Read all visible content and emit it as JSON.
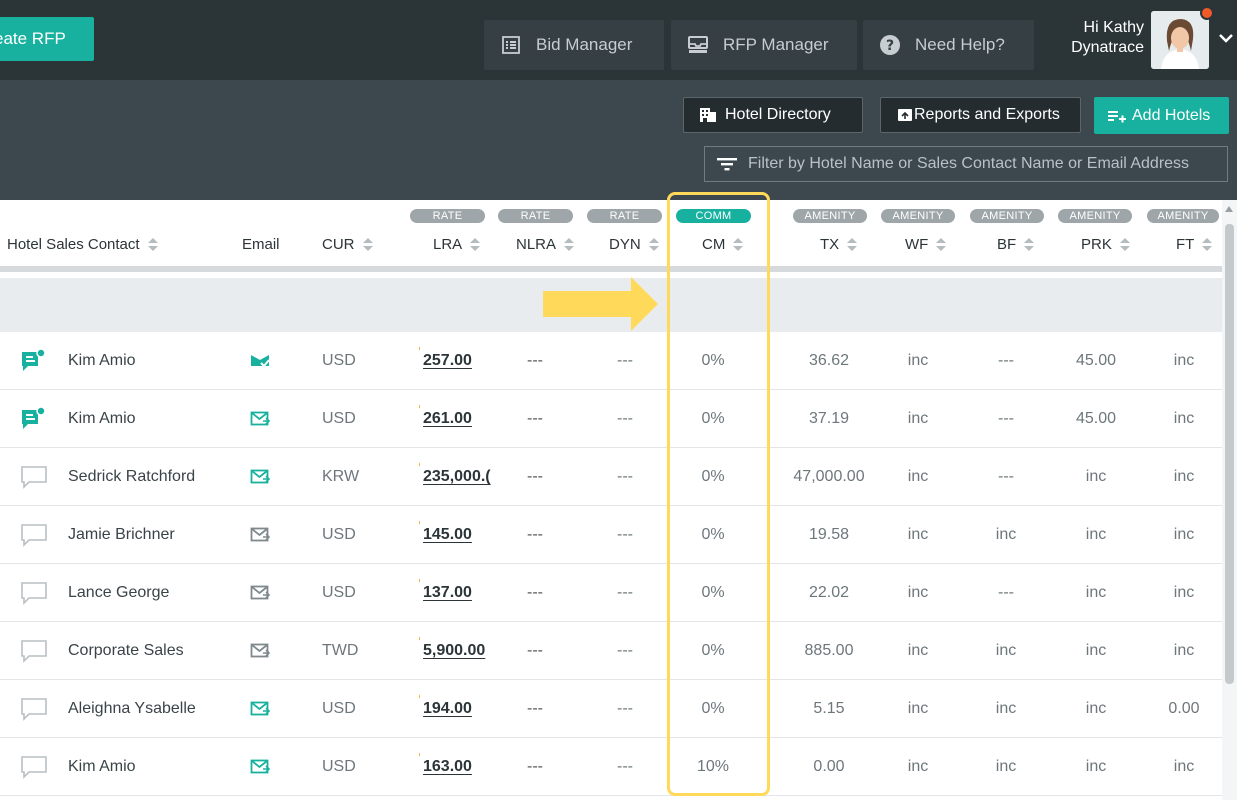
{
  "topbar": {
    "create_rfp_label": "eate RFP",
    "bid_manager_label": "Bid Manager",
    "rfp_manager_label": "RFP Manager",
    "help_label": "Need Help?",
    "greeting": "Hi Kathy",
    "company": "Dynatrace",
    "icons": {
      "bid_manager": "list-icon",
      "rfp_manager": "inbox-icon",
      "help": "question-circle-icon",
      "user_menu": "chevron-down-icon"
    }
  },
  "toolbar": {
    "hotel_directory_label": "Hotel Directory",
    "reports_label": "Reports and Exports",
    "add_hotels_label": "Add Hotels",
    "filter_placeholder": "Filter by Hotel Name or Sales Contact Name or Email Address"
  },
  "colors": {
    "accent": "#18b19f",
    "nav_bg": "#2b3538",
    "toolbar_bg": "#3c484e",
    "highlight": "#ffd95a",
    "lra_marker": "#f5a623"
  },
  "table": {
    "groups": {
      "rate": "RATE",
      "comm": "COMM",
      "amenity": "AMENITY"
    },
    "columns": {
      "contact": "Hotel Sales Contact",
      "email": "Email",
      "cur": "CUR",
      "lra": "LRA",
      "nlra": "NLRA",
      "dyn": "DYN",
      "cm": "CM",
      "tx": "TX",
      "wf": "WF",
      "bf": "BF",
      "prk": "PRK",
      "ft": "FT"
    },
    "rows": [
      {
        "contact": "Kim Amio",
        "chat": "active",
        "email_state": "sent",
        "cur": "USD",
        "lra": "257.00",
        "nlra": "---",
        "dyn": "---",
        "cm": "0%",
        "tx": "36.62",
        "wf": "inc",
        "bf": "---",
        "prk": "45.00",
        "ft": "inc"
      },
      {
        "contact": "Kim Amio",
        "chat": "active",
        "email_state": "reply",
        "cur": "USD",
        "lra": "261.00",
        "nlra": "---",
        "dyn": "---",
        "cm": "0%",
        "tx": "37.19",
        "wf": "inc",
        "bf": "---",
        "prk": "45.00",
        "ft": "inc"
      },
      {
        "contact": "Sedrick Ratchford",
        "chat": "empty",
        "email_state": "reply",
        "cur": "KRW",
        "lra": "235,000.(",
        "nlra": "---",
        "dyn": "---",
        "cm": "0%",
        "tx": "47,000.00",
        "wf": "inc",
        "bf": "---",
        "prk": "inc",
        "ft": "inc"
      },
      {
        "contact": "Jamie Brichner",
        "chat": "empty",
        "email_state": "grey",
        "cur": "USD",
        "lra": "145.00",
        "nlra": "---",
        "dyn": "---",
        "cm": "0%",
        "tx": "19.58",
        "wf": "inc",
        "bf": "inc",
        "prk": "inc",
        "ft": "inc"
      },
      {
        "contact": "Lance George",
        "chat": "empty",
        "email_state": "grey",
        "cur": "USD",
        "lra": "137.00",
        "nlra": "---",
        "dyn": "---",
        "cm": "0%",
        "tx": "22.02",
        "wf": "inc",
        "bf": "---",
        "prk": "inc",
        "ft": "inc"
      },
      {
        "contact": "Corporate Sales",
        "chat": "empty",
        "email_state": "grey",
        "cur": "TWD",
        "lra": "5,900.00",
        "nlra": "---",
        "dyn": "---",
        "cm": "0%",
        "tx": "885.00",
        "wf": "inc",
        "bf": "inc",
        "prk": "inc",
        "ft": "inc"
      },
      {
        "contact": "Aleighna Ysabelle",
        "chat": "empty",
        "email_state": "reply",
        "cur": "USD",
        "lra": "194.00",
        "nlra": "---",
        "dyn": "---",
        "cm": "0%",
        "tx": "5.15",
        "wf": "inc",
        "bf": "inc",
        "prk": "inc",
        "ft": "0.00"
      },
      {
        "contact": "Kim Amio",
        "chat": "empty",
        "email_state": "reply",
        "cur": "USD",
        "lra": "163.00",
        "nlra": "---",
        "dyn": "---",
        "cm": "10%",
        "tx": "0.00",
        "wf": "inc",
        "bf": "inc",
        "prk": "inc",
        "ft": "inc"
      }
    ]
  }
}
